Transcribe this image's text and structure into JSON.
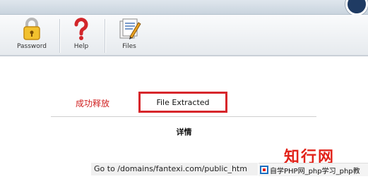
{
  "toolbar": {
    "items": [
      {
        "label": "Password",
        "icon": "lock-icon"
      },
      {
        "label": "Help",
        "icon": "question-mark-icon"
      },
      {
        "label": "Files",
        "icon": "files-icon"
      }
    ]
  },
  "status": {
    "success_text": "成功释放",
    "result_text": "File Extracted",
    "highlight_color": "#d7262b"
  },
  "details": {
    "heading": "详情",
    "goto_text": "Go to /domains/fantexi.com/public_htm"
  },
  "watermark": {
    "title": "知行网",
    "strip_text": "自学PHP网_php学习_php教"
  }
}
